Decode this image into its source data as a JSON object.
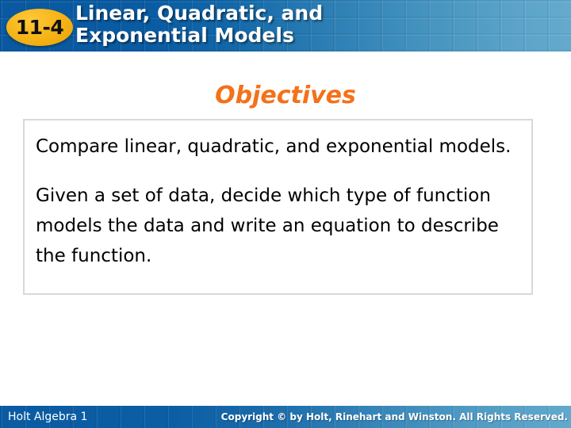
{
  "header": {
    "lesson_badge": "11-4",
    "title_line1": "Linear, Quadratic, and",
    "title_line2": "Exponential Models",
    "gradient_start": "#0a59a0",
    "gradient_end": "#65aacd",
    "badge_color": "#f7b71c",
    "title_color": "#ffffff"
  },
  "objectives": {
    "heading": "Objectives",
    "heading_color": "#f4711a",
    "items": [
      "Compare linear, quadratic, and exponential models.",
      "Given a set of data, decide which type of function models the data and write an equation to describe the function."
    ],
    "box_border_color": "#d9d9d9"
  },
  "footer": {
    "book_title": "Holt Algebra 1",
    "copyright": "Copyright © by Holt, Rinehart and Winston. All Rights Reserved.",
    "bar_color": "#0a5ba2",
    "text_color": "#ffffff"
  }
}
